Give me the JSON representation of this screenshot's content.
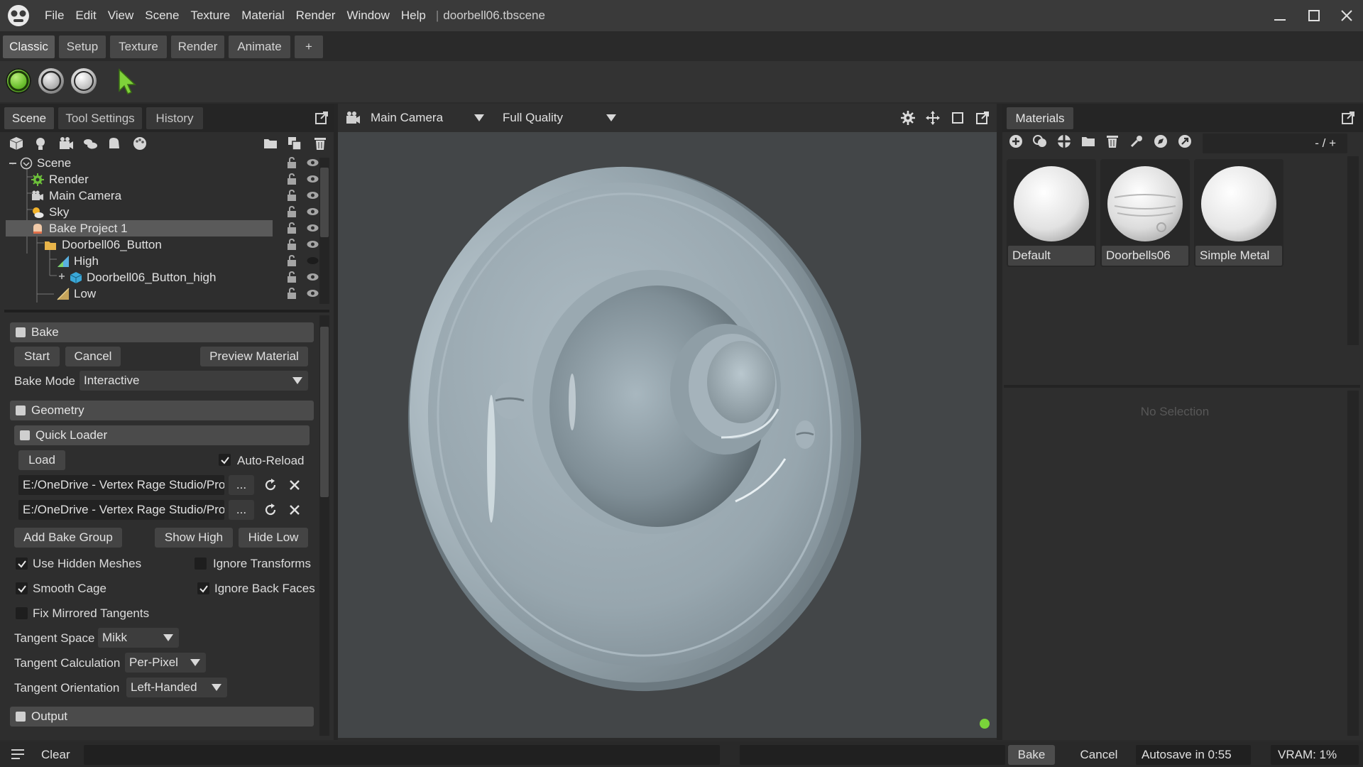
{
  "window": {
    "file_name": "doorbell06.tbscene",
    "separator": "|",
    "menu": [
      "File",
      "Edit",
      "View",
      "Scene",
      "Texture",
      "Material",
      "Render",
      "Window",
      "Help"
    ]
  },
  "workspace_tabs": [
    "Classic",
    "Setup",
    "Texture",
    "Render",
    "Animate",
    "+"
  ],
  "toolbar": {
    "accent": "#79c43a"
  },
  "left_panel": {
    "tabs": [
      "Scene",
      "Tool Settings",
      "History"
    ],
    "tree": [
      {
        "label": "Scene",
        "icon": "scene-icon"
      },
      {
        "label": "Render",
        "icon": "render-gear-icon"
      },
      {
        "label": "Main Camera",
        "icon": "camera-icon"
      },
      {
        "label": "Sky",
        "icon": "sky-icon"
      },
      {
        "label": "Bake Project 1",
        "icon": "bake-project-icon"
      },
      {
        "label": "Doorbell06_Button",
        "icon": "folder-icon"
      },
      {
        "label": "High",
        "icon": "high-mesh-icon"
      },
      {
        "label": "Doorbell06_Button_high",
        "icon": "mesh-icon"
      },
      {
        "label": "Low",
        "icon": "low-mesh-icon"
      }
    ]
  },
  "bake": {
    "section_title": "Bake",
    "start": "Start",
    "cancel": "Cancel",
    "preview_material": "Preview Material",
    "bake_mode_label": "Bake Mode",
    "bake_mode_value": "Interactive",
    "geometry_title": "Geometry",
    "quick_loader_title": "Quick Loader",
    "load": "Load",
    "auto_reload": "Auto-Reload",
    "path1": "E:/OneDrive - Vertex Rage Studio/Pro",
    "path2": "E:/OneDrive - Vertex Rage Studio/Pro",
    "browse": "...",
    "add_bake_group": "Add Bake Group",
    "show_high": "Show High",
    "hide_low": "Hide Low",
    "use_hidden_meshes": "Use Hidden Meshes",
    "ignore_transforms": "Ignore Transforms",
    "smooth_cage": "Smooth Cage",
    "ignore_back_faces": "Ignore Back Faces",
    "fix_mirrored_tangents": "Fix Mirrored Tangents",
    "tangent_space_label": "Tangent Space",
    "tangent_space_value": "Mikk",
    "tangent_calc_label": "Tangent Calculation",
    "tangent_calc_value": "Per-Pixel",
    "tangent_orient_label": "Tangent Orientation",
    "tangent_orient_value": "Left-Handed",
    "output_title": "Output"
  },
  "viewport": {
    "camera": "Main Camera",
    "quality": "Full Quality"
  },
  "materials": {
    "title": "Materials",
    "counter": "- / +",
    "items": [
      "Default",
      "Doorbells06",
      "Simple Metal"
    ],
    "no_selection": "No Selection"
  },
  "status": {
    "clear": "Clear",
    "bake": "Bake",
    "cancel": "Cancel",
    "autosave": "Autosave in 0:55",
    "vram": "VRAM: 1%"
  }
}
